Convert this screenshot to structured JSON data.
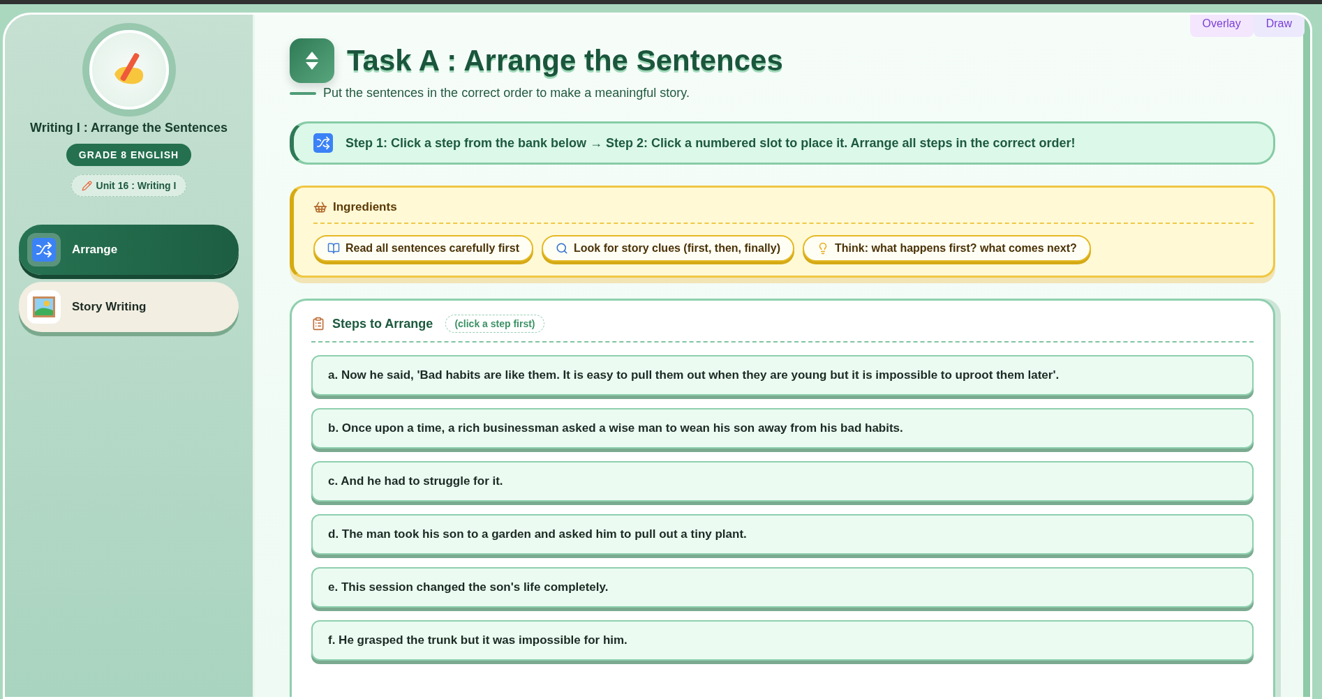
{
  "sidebar": {
    "title": "Writing I : Arrange the Sentences",
    "badge": "GRADE 8 ENGLISH",
    "unit": "Unit 16 : Writing I",
    "items": [
      {
        "label": "Arrange",
        "kind": "shuffle",
        "selected": true
      },
      {
        "label": "Story Writing",
        "kind": "picture",
        "selected": false
      }
    ]
  },
  "toolbar": [
    "Overlay",
    "Draw"
  ],
  "header": {
    "title": "Task A : Arrange the Sentences",
    "subtitle": "Put the sentences in the correct order to make a meaningful story."
  },
  "instructions": "Step 1: Click a step from the bank below → Step 2: Click a numbered slot to place it. Arrange all steps in the correct order!",
  "ingredients": {
    "title": "Ingredients",
    "tips": [
      {
        "label": "Read all sentences carefully first",
        "kind": "book"
      },
      {
        "label": "Look for story clues (first, then, finally)",
        "kind": "search"
      },
      {
        "label": "Think: what happens first? what comes next?",
        "kind": "bulb"
      }
    ]
  },
  "steps": {
    "title": "Steps to Arrange",
    "hint": "(click a step first)",
    "items": [
      "a. Now he said, 'Bad habits are like them. It is easy to pull them out when they are young but it is impossible to uproot them later'.",
      "b. Once upon a time, a rich businessman asked a wise man to wean his son away from his bad habits.",
      "c. And he had to struggle for it.",
      "d. The man took his son to a garden and asked him to pull out a tiny plant.",
      "e. This session changed the son's life completely.",
      "f. He grasped the trunk but it was impossible for him."
    ]
  }
}
